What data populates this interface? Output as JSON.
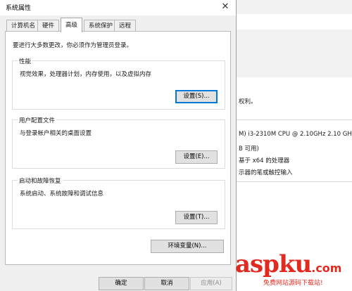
{
  "dialog": {
    "title": "系统属性",
    "close_glyph": "✕",
    "tabs": [
      {
        "label": "计算机名"
      },
      {
        "label": "硬件"
      },
      {
        "label": "高级"
      },
      {
        "label": "系统保护"
      },
      {
        "label": "远程"
      }
    ],
    "active_tab": "高级",
    "admin_note": "要进行大多数更改，你必须作为管理员登录。",
    "performance": {
      "label": "性能",
      "description": "视觉效果，处理器计划，内存使用，以及虚拟内存",
      "button": "设置(S)..."
    },
    "user_profiles": {
      "label": "用户配置文件",
      "description": "与登录帐户相关的桌面设置",
      "button": "设置(E)..."
    },
    "startup_recovery": {
      "label": "启动和故障恢复",
      "description": "系统启动、系统故障和调试信息",
      "button": "设置(T)..."
    },
    "env_button": "环境变量(N)...",
    "ok_button": "确定",
    "cancel_button": "取消",
    "apply_button": "应用(A)"
  },
  "background_window": {
    "rights_text": "权利。",
    "cpu_text": "M) i3-2310M CPU @ 2.10GHz   2.10 GH",
    "ram_text": "B 可用)",
    "arch_text": "基于 x64 的处理器",
    "pen_text": "示器的笔或触控输入"
  },
  "watermark": {
    "brand": "aspku",
    "tld": ".com",
    "subtitle": "免费网站源码下载站!"
  },
  "colors": {
    "accent": "#0078d7",
    "watermark": "#e02a20"
  }
}
